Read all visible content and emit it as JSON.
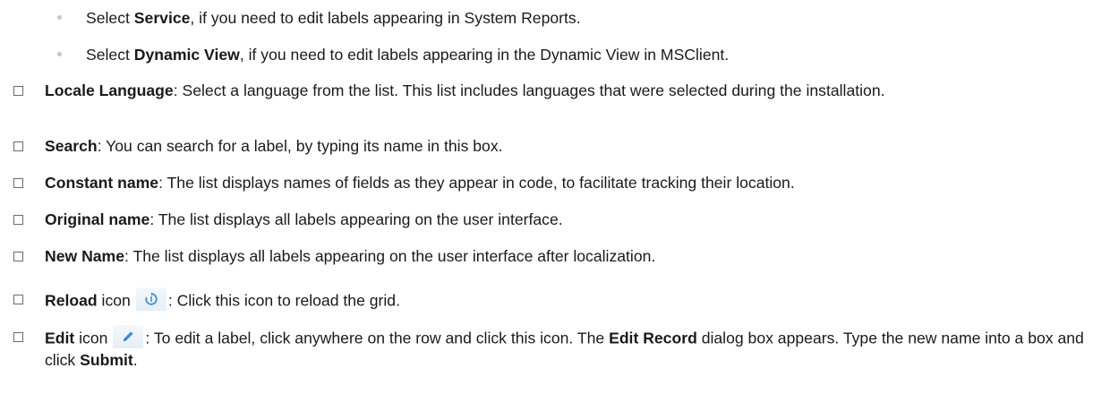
{
  "sub_items": [
    {
      "pre": "Select ",
      "bold": "Service",
      "post": ", if you need to edit labels appearing in System Reports."
    },
    {
      "pre": "Select ",
      "bold": "Dynamic View",
      "post": ", if you need to edit labels appearing in the Dynamic View in MSClient."
    }
  ],
  "items": [
    {
      "bold": "Locale Language",
      "text": ": Select a language from the list. This list includes languages that were selected during the installation."
    },
    {
      "bold": "Search",
      "text": ": You can search for a label, by typing its name in this box."
    },
    {
      "bold": "Constant name",
      "text": ": The list displays names of fields as they appear in code, to facilitate tracking their location."
    },
    {
      "bold": "Original name",
      "text": ": The list displays all labels appearing on the user interface."
    },
    {
      "bold": "New Name",
      "text": ": The list displays all labels appearing on the user interface after localization."
    }
  ],
  "reload": {
    "bold": "Reload",
    "pre_icon": " icon",
    "post_icon": ": Click this icon to reload the grid.",
    "icon_name": "reload-icon",
    "icon_color": "#3f8fd6"
  },
  "edit": {
    "bold": "Edit",
    "pre_icon": " icon",
    "post_icon_1": ": To edit a label, click anywhere on the row and click this icon. The ",
    "bold_2": "Edit Record",
    "post_2": " dialog box appears. Type the new name into a box and click ",
    "bold_3": "Submit",
    "post_3": ".",
    "icon_name": "pencil-icon",
    "icon_color": "#3f8fd6"
  }
}
